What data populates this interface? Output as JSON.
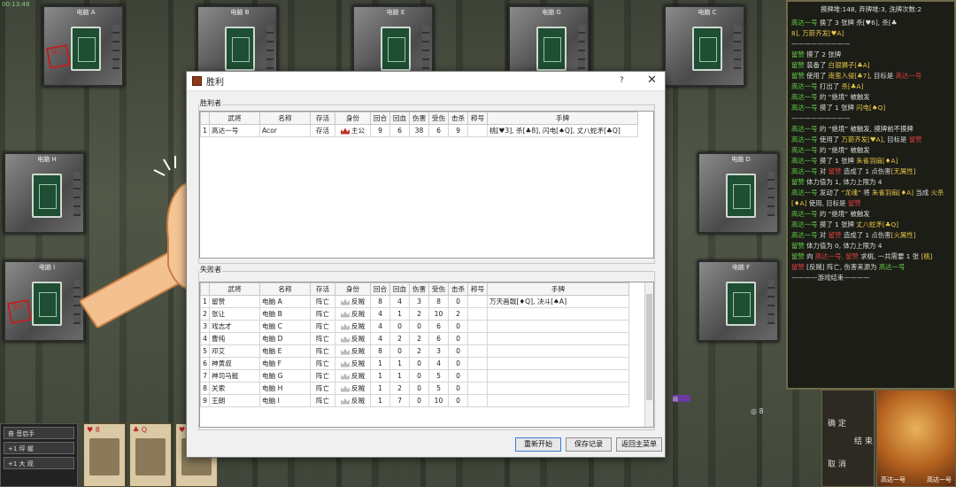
{
  "clock": "00:13:48",
  "seats": [
    {
      "name": "电脑 A"
    },
    {
      "name": "电脑 B"
    },
    {
      "name": "电脑 E"
    },
    {
      "name": "电脑 G"
    },
    {
      "name": "电脑 C"
    },
    {
      "name": "电脑 H"
    },
    {
      "name": "电脑 D"
    },
    {
      "name": "电脑 I"
    },
    {
      "name": "电脑 F"
    }
  ],
  "dead_label": "阵亡",
  "log": {
    "stats": "摸牌堆:148, 弃牌堆:3, 洗牌次数:2",
    "lines": [
      [
        {
          "t": "高达一号",
          "c": "g"
        },
        {
          "t": " 换了 3 张牌 杀[♥6], 杀[♣"
        },
        {
          "t": ""
        }
      ],
      [
        {
          "t": "8], 万箭齐发[♥A]",
          "c": "y"
        }
      ],
      [
        {
          "t": "—————————"
        }
      ],
      [
        {
          "t": "留赞",
          "c": "g"
        },
        {
          "t": " 摸了 2 张牌"
        }
      ],
      [
        {
          "t": "留赞",
          "c": "g"
        },
        {
          "t": " 装备了 "
        },
        {
          "t": "白银狮子[♣A]",
          "c": "y"
        }
      ],
      [
        {
          "t": "留赞",
          "c": "g"
        },
        {
          "t": " 使用了 "
        },
        {
          "t": "南蛮入侵[♣7]",
          "c": "y"
        },
        {
          "t": ", 目标是 "
        },
        {
          "t": "高达一号",
          "c": "r"
        }
      ],
      [
        {
          "t": "高达一号",
          "c": "g"
        },
        {
          "t": " 打出了 "
        },
        {
          "t": "杀[♣A]",
          "c": "y"
        }
      ],
      [
        {
          "t": "高达一号",
          "c": "g"
        },
        {
          "t": " 的 “绝境” 被触发"
        }
      ],
      [
        {
          "t": "高达一号",
          "c": "g"
        },
        {
          "t": " 摸了 1 张牌 "
        },
        {
          "t": "闪电[♠Q]",
          "c": "y"
        }
      ],
      [
        {
          "t": "—————————"
        }
      ],
      [
        {
          "t": "高达一号",
          "c": "g"
        },
        {
          "t": " 的 “绝境” 被触发, 摸牌前不摸牌"
        }
      ],
      [
        {
          "t": "高达一号",
          "c": "g"
        },
        {
          "t": " 使用了 "
        },
        {
          "t": "万箭齐发[♥A]",
          "c": "y"
        },
        {
          "t": ", 目标是 "
        },
        {
          "t": "留赞",
          "c": "r"
        }
      ],
      [
        {
          "t": "高达一号",
          "c": "g"
        },
        {
          "t": " 的 “绝境” 被触发"
        }
      ],
      [
        {
          "t": "高达一号",
          "c": "g"
        },
        {
          "t": " 摸了 1 张牌 "
        },
        {
          "t": "朱雀羽扇[♦A]",
          "c": "y"
        }
      ],
      [
        {
          "t": "高达一号",
          "c": "g"
        },
        {
          "t": " 对 "
        },
        {
          "t": "留赞",
          "c": "r"
        },
        {
          "t": " 造成了 1 点伤害"
        },
        {
          "t": "[无属性]",
          "c": "y"
        }
      ],
      [
        {
          "t": "留赞",
          "c": "g"
        },
        {
          "t": " 体力值为 1, 体力上限为 4"
        }
      ],
      [
        {
          "t": "高达一号",
          "c": "g"
        },
        {
          "t": " 发动了 "
        },
        {
          "t": "“龙魂”",
          "c": "y"
        },
        {
          "t": " 将 "
        },
        {
          "t": "朱雀羽扇[♦A]",
          "c": "y"
        },
        {
          "t": " 当成 "
        },
        {
          "t": "火杀[♦A]",
          "c": "y"
        },
        {
          "t": " 使用, 目标是 "
        },
        {
          "t": "留赞",
          "c": "r"
        }
      ],
      [
        {
          "t": "高达一号",
          "c": "g"
        },
        {
          "t": " 的 “绝境” 被触发"
        }
      ],
      [
        {
          "t": "高达一号",
          "c": "g"
        },
        {
          "t": " 摸了 1 张牌 "
        },
        {
          "t": "丈八蛇矛[♣Q]",
          "c": "y"
        }
      ],
      [
        {
          "t": "高达一号",
          "c": "g"
        },
        {
          "t": " 对 "
        },
        {
          "t": "留赞",
          "c": "r"
        },
        {
          "t": " 造成了 1 点伤害"
        },
        {
          "t": "[火属性]",
          "c": "y"
        }
      ],
      [
        {
          "t": "留赞",
          "c": "g"
        },
        {
          "t": " 体力值为 0, 体力上限为 4"
        }
      ],
      [
        {
          "t": "留赞",
          "c": "g"
        },
        {
          "t": " 向 "
        },
        {
          "t": "高达一号, 留赞",
          "c": "r"
        },
        {
          "t": " 求桃, 一共需要 1 张 "
        },
        {
          "t": "[桃]",
          "c": "y"
        }
      ],
      [
        {
          "t": "留赞",
          "c": "r"
        },
        {
          "t": " [反贼] 阵亡, 伤害来源为 "
        },
        {
          "t": "高达一号",
          "c": "g"
        }
      ],
      [
        {
          "t": "————游戏结束————"
        }
      ]
    ]
  },
  "skills": [
    "奋 音启手",
    "+1 坪 幄",
    "+1 大 观"
  ],
  "hand_cards": [
    {
      "suit": "♥ 8"
    },
    {
      "suit": "♣ Q"
    },
    {
      "suit": "♥ 8"
    }
  ],
  "player": {
    "btn_confirm": "确 定",
    "btn_cancel": "取 消",
    "btn_end": "结 束",
    "bottom_left": "高达一号",
    "bottom_right": "高达一号"
  },
  "vbar_text": "线",
  "coin": "◎ 8",
  "dialog": {
    "title": "胜利",
    "help": "?",
    "close": "✕",
    "winners_label": "胜利者",
    "losers_label": "失败者",
    "columns": [
      "",
      "武将",
      "名称",
      "存活",
      "身份",
      "回合",
      "回血",
      "伤害",
      "受伤",
      "击杀",
      "称号",
      "手牌"
    ],
    "winners": [
      {
        "idx": "1",
        "general": "高达一号",
        "name": "Acor",
        "alive": "存活",
        "role": "主公",
        "rounds": "9",
        "heal": "6",
        "damage": "38",
        "hurt": "6",
        "kills": "9",
        "title": "",
        "hand": "桃[♥3], 杀[♣8], 闪电[♠Q], 丈八蛇矛[♣Q]"
      }
    ],
    "losers": [
      {
        "idx": "1",
        "general": "留赞",
        "name": "电脑 A",
        "alive": "阵亡",
        "role": "反贼",
        "rounds": "8",
        "heal": "4",
        "damage": "3",
        "hurt": "8",
        "kills": "0",
        "title": "",
        "hand": "万天画戟[♦Q], 决斗[♠A]"
      },
      {
        "idx": "2",
        "general": "张让",
        "name": "电脑 B",
        "alive": "阵亡",
        "role": "反贼",
        "rounds": "4",
        "heal": "1",
        "damage": "2",
        "hurt": "10",
        "kills": "2",
        "title": "",
        "hand": ""
      },
      {
        "idx": "3",
        "general": "戏志才",
        "name": "电脑 C",
        "alive": "阵亡",
        "role": "反贼",
        "rounds": "4",
        "heal": "0",
        "damage": "0",
        "hurt": "6",
        "kills": "0",
        "title": "",
        "hand": ""
      },
      {
        "idx": "4",
        "general": "曹纯",
        "name": "电脑 D",
        "alive": "阵亡",
        "role": "反贼",
        "rounds": "4",
        "heal": "2",
        "damage": "2",
        "hurt": "6",
        "kills": "0",
        "title": "",
        "hand": ""
      },
      {
        "idx": "5",
        "general": "邓艾",
        "name": "电脑 E",
        "alive": "阵亡",
        "role": "反贼",
        "rounds": "8",
        "heal": "0",
        "damage": "2",
        "hurt": "3",
        "kills": "0",
        "title": "",
        "hand": ""
      },
      {
        "idx": "6",
        "general": "神黄叔",
        "name": "电脑 F",
        "alive": "阵亡",
        "role": "反贼",
        "rounds": "1",
        "heal": "1",
        "damage": "0",
        "hurt": "4",
        "kills": "0",
        "title": "",
        "hand": ""
      },
      {
        "idx": "7",
        "general": "神司马懿",
        "name": "电脑 G",
        "alive": "阵亡",
        "role": "反贼",
        "rounds": "1",
        "heal": "1",
        "damage": "0",
        "hurt": "5",
        "kills": "0",
        "title": "",
        "hand": ""
      },
      {
        "idx": "8",
        "general": "关索",
        "name": "电脑 H",
        "alive": "阵亡",
        "role": "反贼",
        "rounds": "1",
        "heal": "2",
        "damage": "0",
        "hurt": "5",
        "kills": "0",
        "title": "",
        "hand": ""
      },
      {
        "idx": "9",
        "general": "王朗",
        "name": "电脑 I",
        "alive": "阵亡",
        "role": "反贼",
        "rounds": "1",
        "heal": "7",
        "damage": "0",
        "hurt": "10",
        "kills": "0",
        "title": "",
        "hand": ""
      }
    ],
    "buttons": {
      "restart": "重新开始",
      "save": "保存记录",
      "menu": "返回主菜单"
    }
  }
}
